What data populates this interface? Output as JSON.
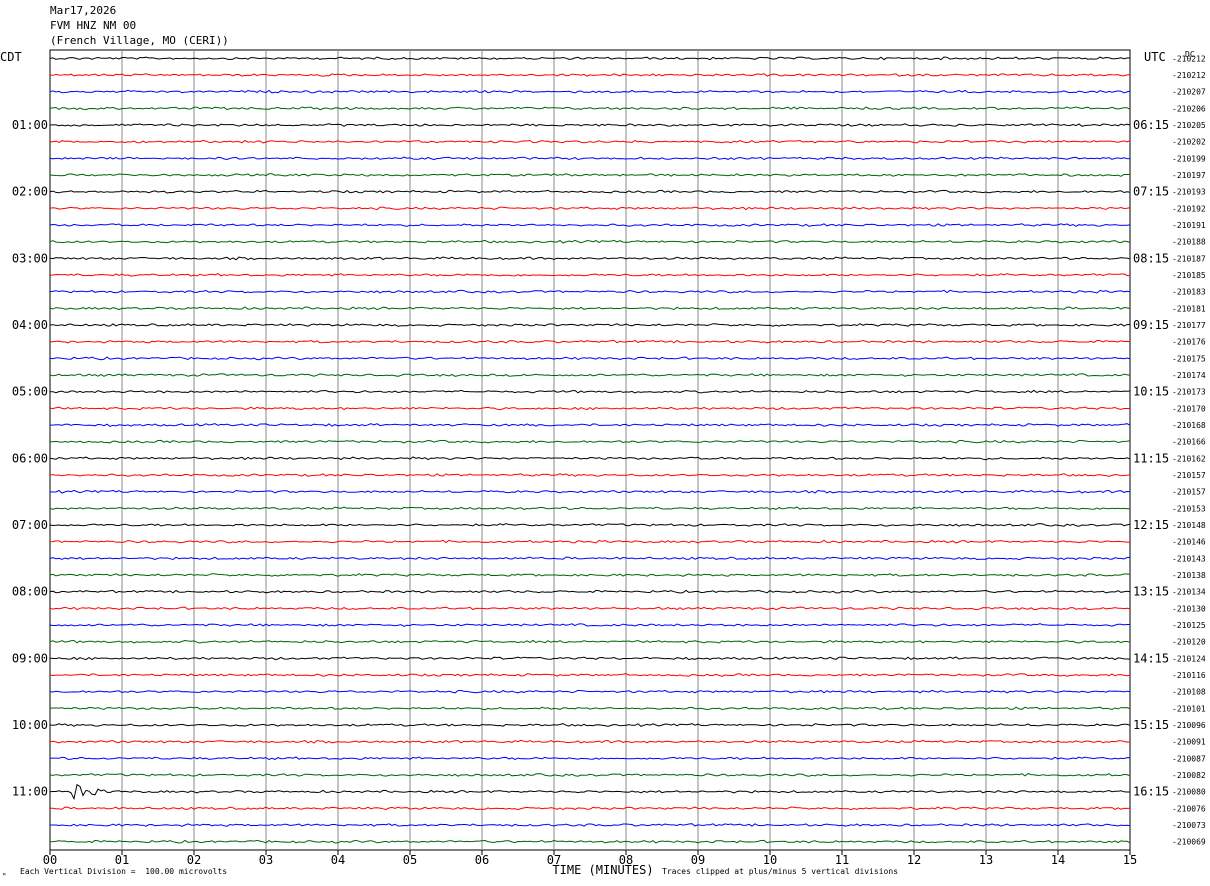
{
  "header": {
    "date": "Mar17,2026",
    "station": "FVM HNZ NM 00",
    "location": "(French Village, MO (CERI))"
  },
  "axis": {
    "left_label": "CDT",
    "right_label": "UTC",
    "dc_label": "DC",
    "xlabel": "TIME (MINUTES)"
  },
  "footer": {
    "scale": "Each Vertical Division =  100.00 microvolts",
    "clip": "Traces clipped at plus/minus 5 vertical divisions"
  },
  "chart_data": {
    "type": "line",
    "title": "FVM HNZ NM 00",
    "xlabel": "TIME (MINUTES)",
    "xlim": [
      0,
      15
    ],
    "x_ticks": [
      "00",
      "01",
      "02",
      "03",
      "04",
      "05",
      "06",
      "07",
      "08",
      "09",
      "10",
      "11",
      "12",
      "13",
      "14",
      "15"
    ],
    "left_hour_labels": [
      "01:00",
      "02:00",
      "03:00",
      "04:00",
      "05:00",
      "06:00",
      "07:00",
      "08:00",
      "09:00",
      "10:00",
      "11:00"
    ],
    "right_hour_labels": [
      "06:15",
      "07:15",
      "08:15",
      "09:15",
      "10:15",
      "11:15",
      "12:15",
      "13:15",
      "14:15",
      "15:15",
      "16:15"
    ],
    "trace_colors": [
      "#000000",
      "#ff0000",
      "#0000ff",
      "#006400"
    ],
    "dc_offsets": [
      "-210212",
      "-210212",
      "-210207",
      "-210206",
      "-210205",
      "-210202",
      "-210199",
      "-210197",
      "-210193",
      "-210192",
      "-210191",
      "-210188",
      "-210187",
      "-210185",
      "-210183",
      "-210181",
      "-210177",
      "-210176",
      "-210175",
      "-210174",
      "-210173",
      "-210170",
      "-210168",
      "-210166",
      "-210162",
      "-210157",
      "-210157",
      "-210153",
      "-210148",
      "-210146",
      "-210143",
      "-210138",
      "-210134",
      "-210130",
      "-210125",
      "-210120",
      "-210124",
      "-210116",
      "-210108",
      "-210101",
      "-210096",
      "-210091",
      "-210087",
      "-210082",
      "-210080",
      "-210076",
      "-210073",
      "-210069"
    ],
    "event": {
      "trace_index": 44,
      "minute": 0.4
    },
    "grid": true
  }
}
